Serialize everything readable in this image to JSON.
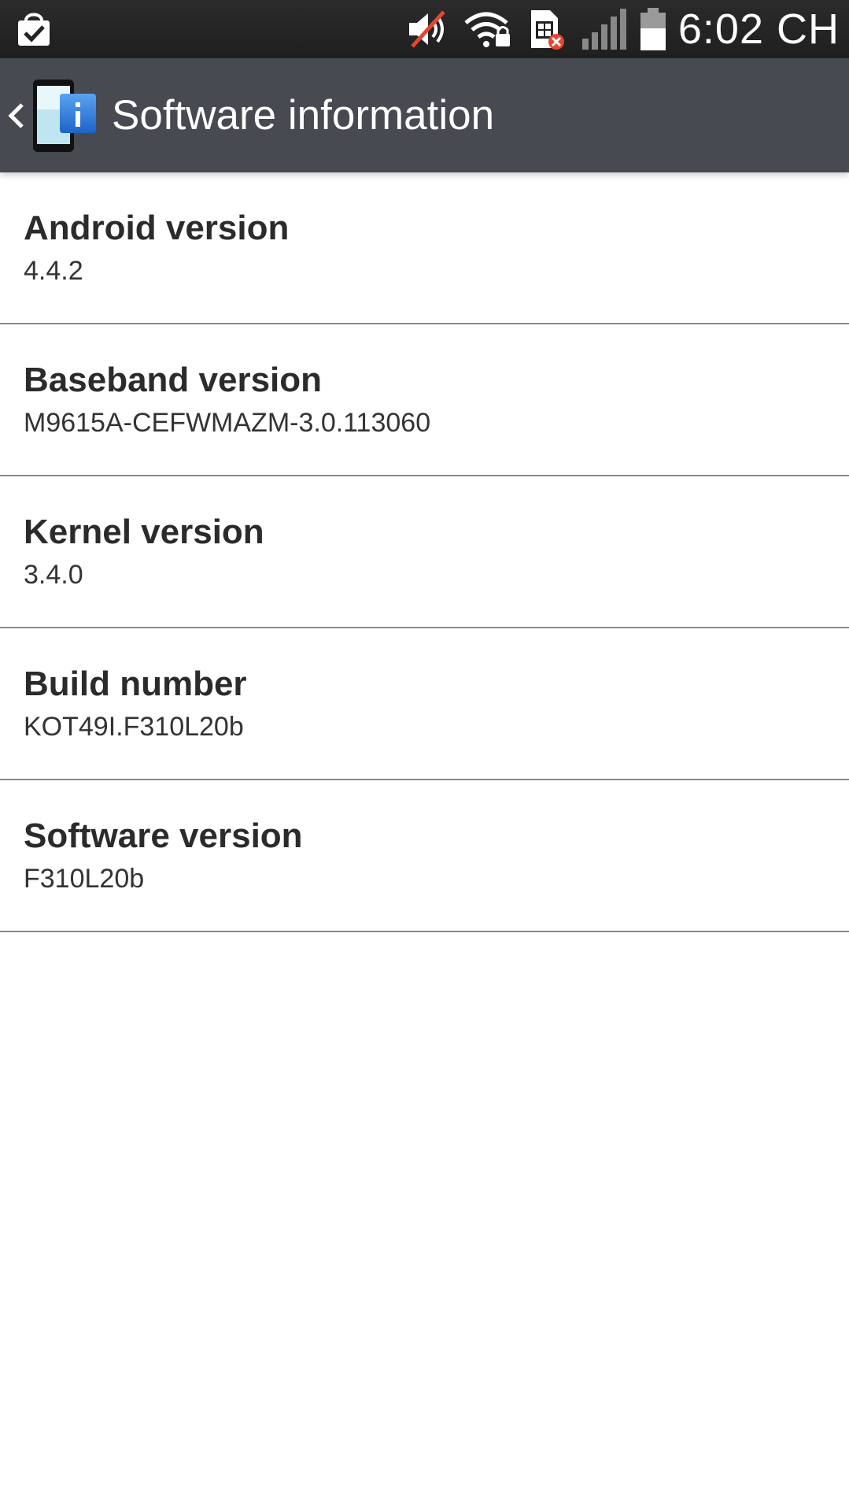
{
  "status_bar": {
    "time": "6:02 CH",
    "left_icon": "shopping-bag-check-icon",
    "icons": [
      "mute-icon",
      "wifi-lock-icon",
      "sim-error-icon",
      "signal-icon",
      "battery-icon"
    ]
  },
  "action_bar": {
    "title": "Software information",
    "back_icon": "chevron-left-icon",
    "app_icon": "phone-info-icon"
  },
  "items": [
    {
      "title": "Android version",
      "value": "4.4.2"
    },
    {
      "title": "Baseband version",
      "value": "M9615A-CEFWMAZM-3.0.113060"
    },
    {
      "title": "Kernel version",
      "value": "3.4.0"
    },
    {
      "title": "Build number",
      "value": "KOT49I.F310L20b"
    },
    {
      "title": "Software version",
      "value": "F310L20b"
    }
  ],
  "colors": {
    "status_bar": "#222222",
    "action_bar": "#474a51",
    "divider": "#8a8a8a",
    "background": "#ffffff"
  }
}
